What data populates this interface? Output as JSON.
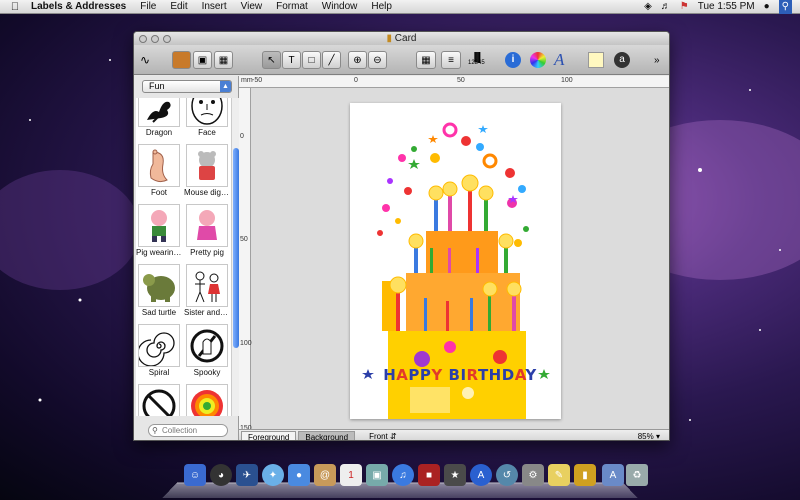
{
  "menubar": {
    "app_name": "Labels & Addresses",
    "items": [
      "File",
      "Edit",
      "Insert",
      "View",
      "Format",
      "Window",
      "Help"
    ],
    "clock": "Tue 1:55 PM"
  },
  "window": {
    "title": "Card",
    "category_select": "Fun",
    "collection_placeholder": "Collection",
    "clipart": [
      {
        "label": "Dragon"
      },
      {
        "label": "Face"
      },
      {
        "label": "Foot"
      },
      {
        "label": "Mouse digger"
      },
      {
        "label": "Pig wearing ..."
      },
      {
        "label": "Pretty pig"
      },
      {
        "label": "Sad turtle"
      },
      {
        "label": "Sister and b..."
      },
      {
        "label": "Spiral"
      },
      {
        "label": "Spooky"
      },
      {
        "label": ""
      },
      {
        "label": ""
      }
    ],
    "ruler_top_labels": [
      "mm",
      "-50",
      "0",
      "50",
      "100"
    ],
    "ruler_left_labels": [
      "0",
      "50",
      "100",
      "150"
    ],
    "status": {
      "tab_foreground": "Foreground",
      "tab_background": "Background",
      "side": "Front",
      "zoom": "85%"
    },
    "barcode_label": "12345"
  },
  "card": {
    "greeting": "HAPPY BIRTHDAY",
    "letter_colors": [
      "#2b3fa8",
      "#e23a2a",
      "#2b3fa8",
      "#2b3fa8",
      "#e23a2a",
      "#2b3fa8",
      "#2b3fa8",
      "#e23a2a",
      "#2b3fa8",
      "#2b3fa8",
      "#2b3fa8",
      "#e23a2a",
      "#2b3fa8",
      "#2b3fa8"
    ]
  }
}
